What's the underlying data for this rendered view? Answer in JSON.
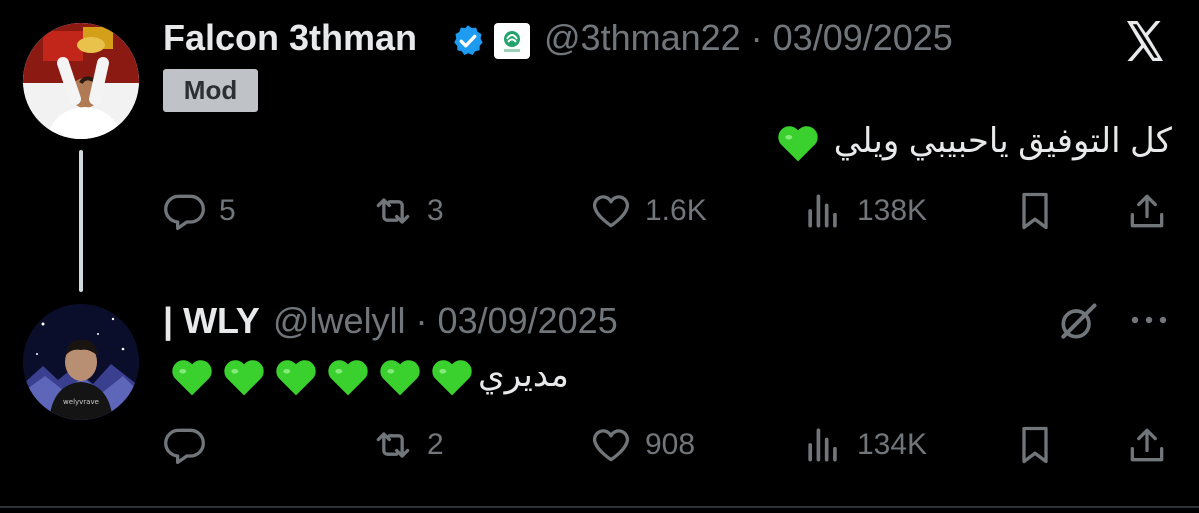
{
  "tweet1": {
    "author_name": "Falcon 3thman",
    "handle_and_date": "@3thman22 · 03/09/2025",
    "tag": "Mod",
    "text": "كل التوفيق ياحبيبي ويلي",
    "text_emoji_count": 1,
    "replies": "5",
    "reposts": "3",
    "likes": "1.6K",
    "views": "138K"
  },
  "tweet2": {
    "author_name": "| WLY",
    "handle_and_date": "@lwelyll · 03/09/2025",
    "text_prefix_emoji_count": 6,
    "text": "مديري",
    "replies": "",
    "reposts": "2",
    "likes": "908",
    "views": "134K"
  },
  "colors": {
    "background": "#000000",
    "text_primary": "#e7e9ea",
    "text_secondary": "#71767b",
    "verified_blue": "#1d9bf0",
    "heart_green": "#3ad12e",
    "mod_tag_bg": "#bfc3c7"
  },
  "icons": [
    "verified-badge-icon",
    "affiliate-badge-icon",
    "x-logo-icon",
    "reply-icon",
    "repost-icon",
    "like-icon",
    "views-icon",
    "bookmark-icon",
    "share-icon",
    "grok-icon",
    "more-icon",
    "green-heart-emoji"
  ]
}
